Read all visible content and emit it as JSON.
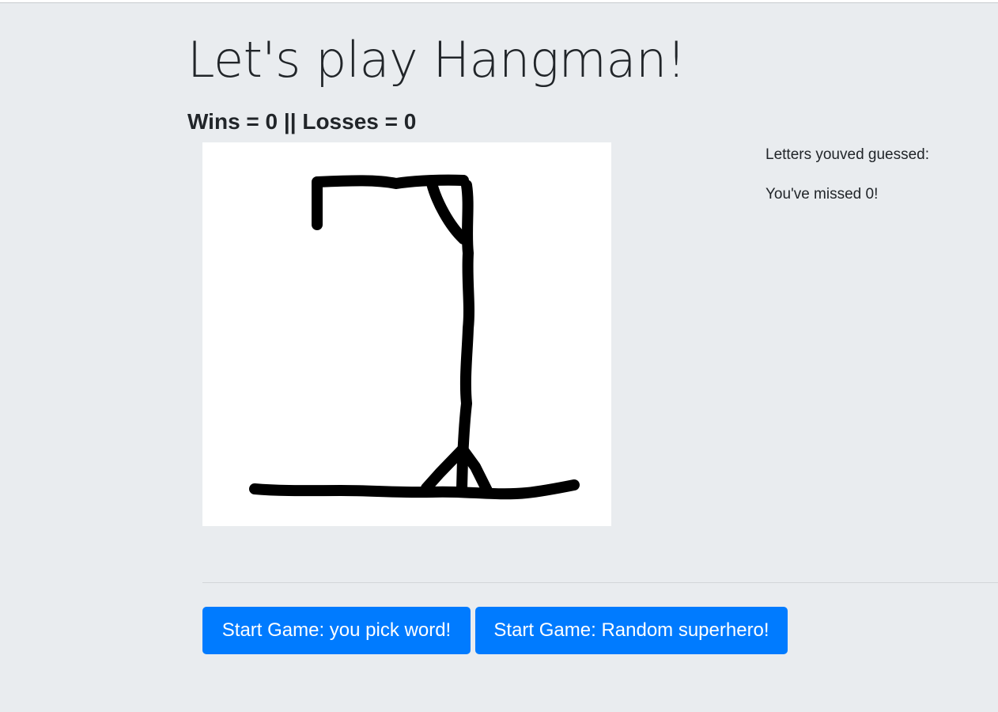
{
  "page": {
    "title": "Let's play Hangman!",
    "score_text": "Wins = 0 || Losses = 0"
  },
  "status": {
    "guessed_label": "Letters youved guessed:",
    "missed_text": "You've missed 0!"
  },
  "buttons": {
    "pick_word": "Start Game: you pick word!",
    "random_superhero": "Start Game: Random superhero!"
  },
  "colors": {
    "background": "#e9ecef",
    "primary": "#007bff",
    "text": "#212529",
    "drawing_stroke": "#000000",
    "drawing_canvas": "#ffffff"
  }
}
